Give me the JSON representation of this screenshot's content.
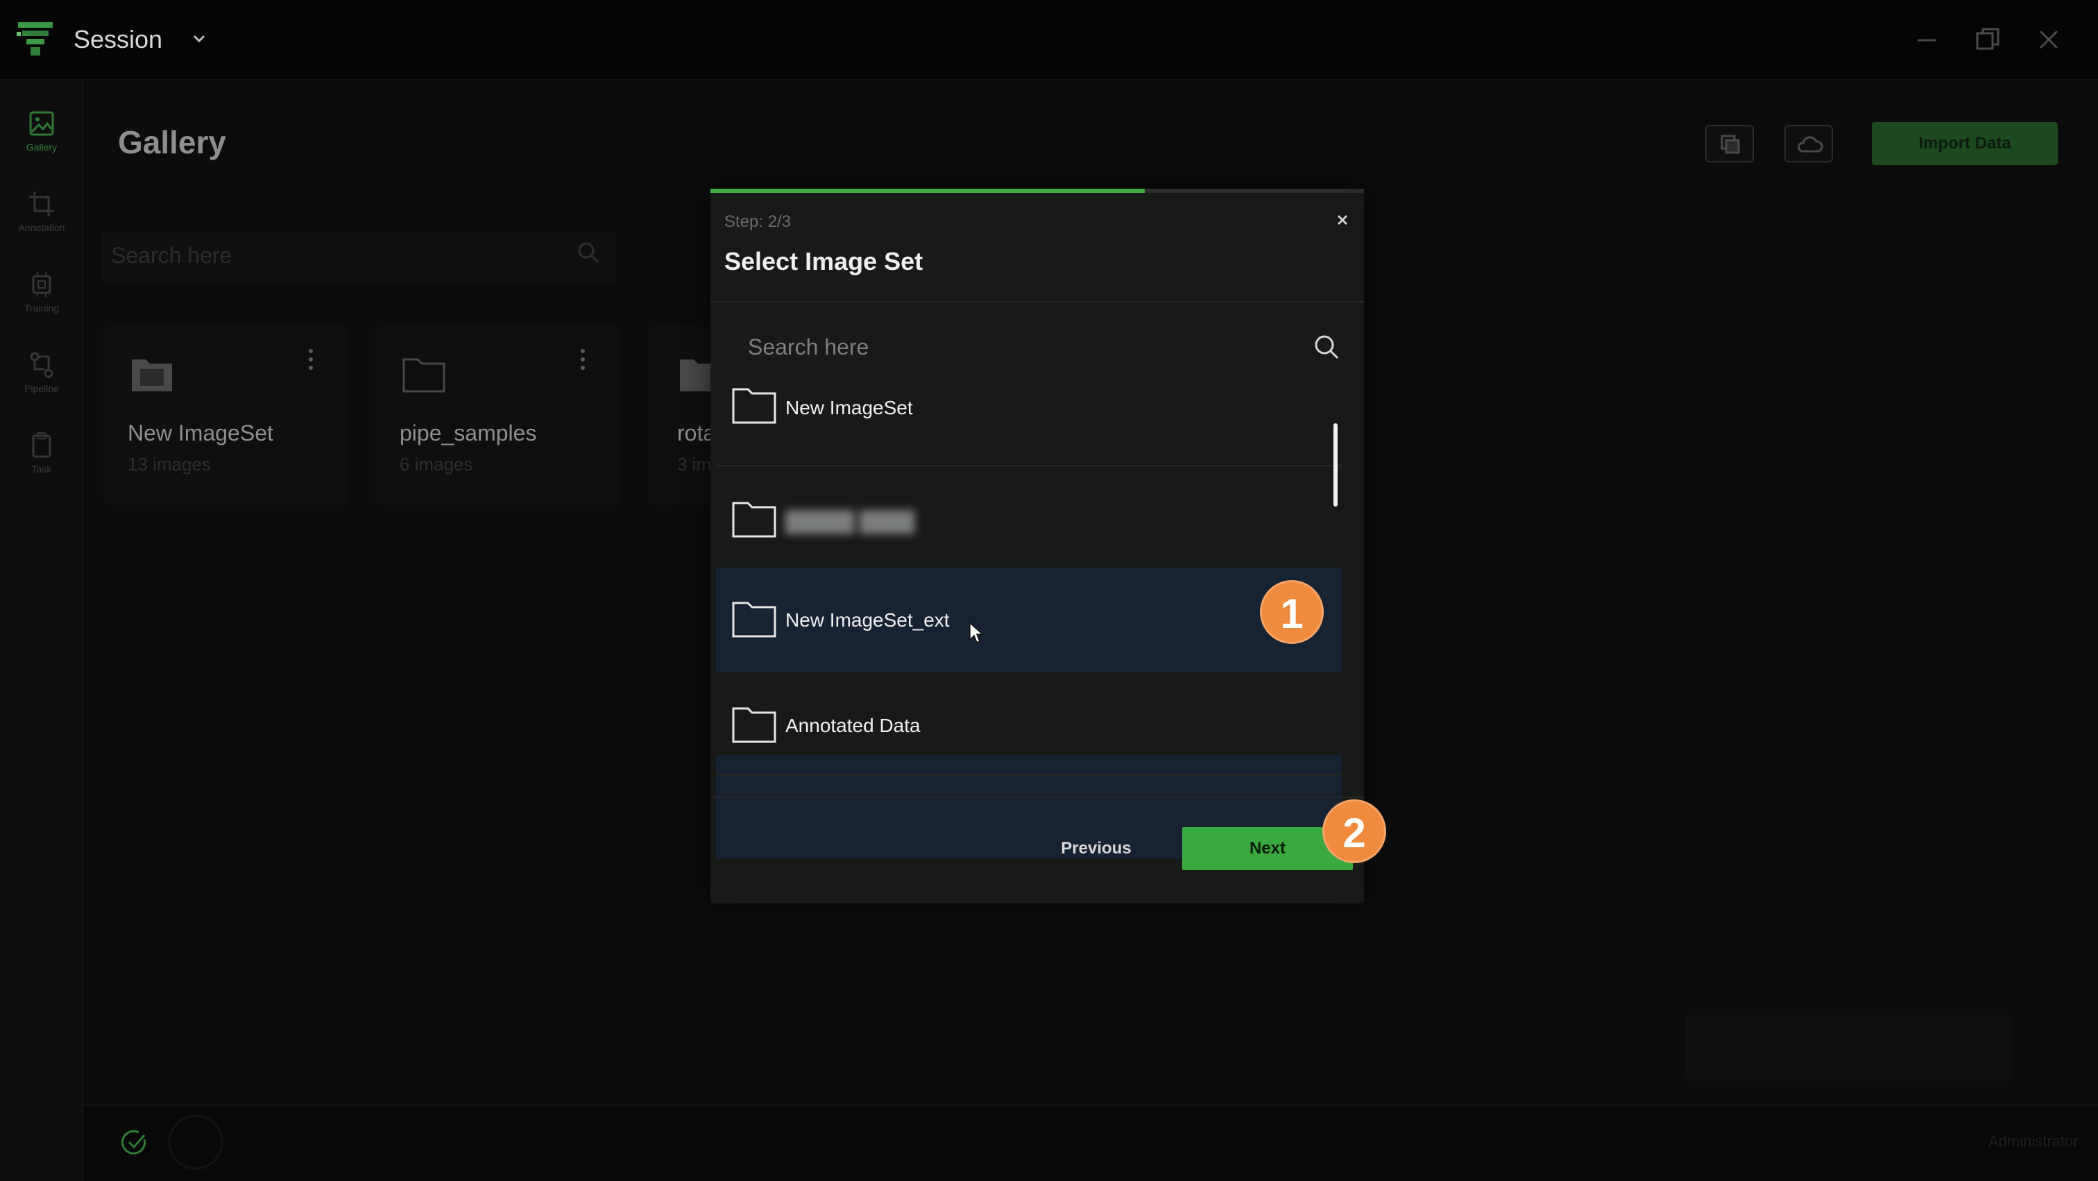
{
  "app": {
    "title": "Session",
    "window_controls": [
      "minimize-icon",
      "restore-icon",
      "close-icon"
    ]
  },
  "rail": {
    "items": [
      {
        "label": "Gallery",
        "icon": "image-icon",
        "active": true
      },
      {
        "label": "Annotation",
        "icon": "crop-icon",
        "active": false
      },
      {
        "label": "Training",
        "icon": "chip-icon",
        "active": false
      },
      {
        "label": "Pipeline",
        "icon": "pipeline-icon",
        "active": false
      },
      {
        "label": "Task",
        "icon": "clipboard-icon",
        "active": false
      }
    ]
  },
  "gallery": {
    "title": "Gallery",
    "search_placeholder": "Search here",
    "import_label": "Import Data",
    "cards": [
      {
        "name": "New ImageSet",
        "count": "13 images"
      },
      {
        "name": "pipe_samples",
        "count": "6 images"
      },
      {
        "name": "rota",
        "count": "3 im"
      }
    ]
  },
  "modal": {
    "step": "Step: 2/3",
    "progress_fraction": 0.665,
    "title": "Select Image Set",
    "search_placeholder": "Search here",
    "items": [
      {
        "label": "New ImageSet",
        "selected": false,
        "blurred": false
      },
      {
        "label": "█████ ████",
        "selected": false,
        "blurred": true
      },
      {
        "label": "New ImageSet_ext",
        "selected": true,
        "blurred": false
      },
      {
        "label": "Annotated Data",
        "selected": false,
        "blurred": false
      }
    ],
    "previous_label": "Previous",
    "next_label": "Next"
  },
  "annotations": {
    "badge_1": "1",
    "badge_2": "2"
  },
  "status": {
    "user": "Administrator"
  },
  "colors": {
    "accent": "#3aaa40",
    "badge": "#f08a3c",
    "selected_row": "#172233"
  }
}
